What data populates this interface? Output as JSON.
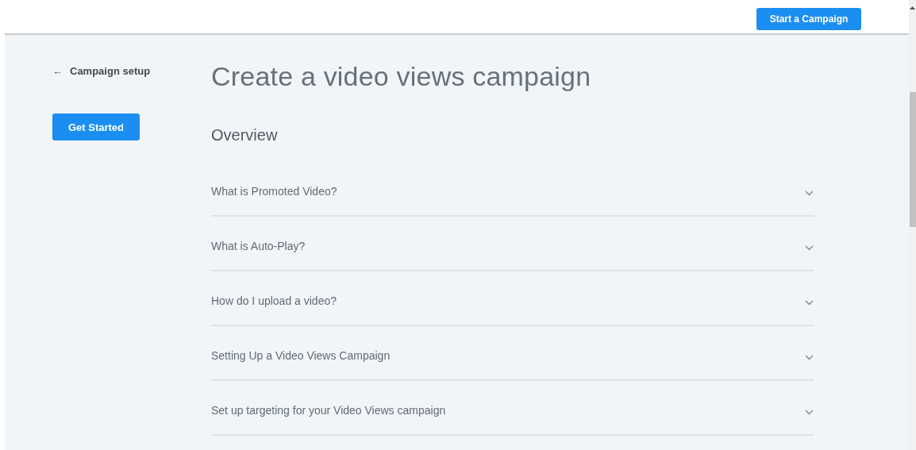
{
  "header": {
    "action_button": "Start a Campaign"
  },
  "sidebar": {
    "back_link": {
      "icon": "←",
      "label": "Campaign setup"
    },
    "button": "Get Started"
  },
  "main": {
    "title": "Create a video views campaign",
    "section_title": "Overview",
    "faq": [
      {
        "question": "What is Promoted Video?",
        "expanded": false
      },
      {
        "question": "What is Auto-Play?",
        "expanded": false
      },
      {
        "question": "How do I upload a video?",
        "expanded": false
      },
      {
        "question": "Setting Up a Video Views Campaign",
        "expanded": false
      },
      {
        "question": "Set up targeting for your Video Views campaign",
        "expanded": false
      }
    ]
  }
}
